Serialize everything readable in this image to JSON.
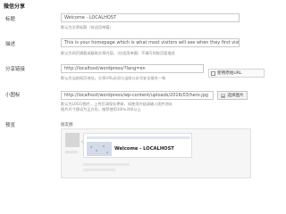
{
  "section": {
    "title": "微信分享"
  },
  "fields": {
    "title": {
      "label": "标题",
      "value": "Welcome - LOCALHOST",
      "help": "默认为文章标题（仅适用单篇）"
    },
    "description": {
      "label": "描述",
      "value": "This is your homepage which is what most visitors will see when they first visit your site",
      "help": "默认为网页摘要或截取文章内容。（仅适用单篇）不填写则取页面描述"
    },
    "share_link": {
      "label": "分享链接",
      "value": "http://localhost/wordpress/?lang=en",
      "help": "默认为当前网页地址。分享URL必须与当前公众号安全域名一致",
      "checkbox_label": "使用原始URL"
    },
    "thumbnail": {
      "label": "小图标",
      "value": "http://localhost/wordpress/wp-content/uploads/2016/03/hero.jpg",
      "help_line1": "默认为LOGO图片，上传后请保存更新，如使用外链请输入图片地址",
      "help_line2": "图片尺寸建议为正方形，推荐使用300x300以上",
      "upload_label": "选择图片",
      "upload_icon": "image-icon"
    }
  },
  "preview": {
    "label": "预览",
    "caption": "朋友圈",
    "card_title": "Welcome - LOCALHOST"
  },
  "colors": {
    "bubble_header": "#dfe5f0",
    "thumbnail": "#d3dbe9"
  }
}
